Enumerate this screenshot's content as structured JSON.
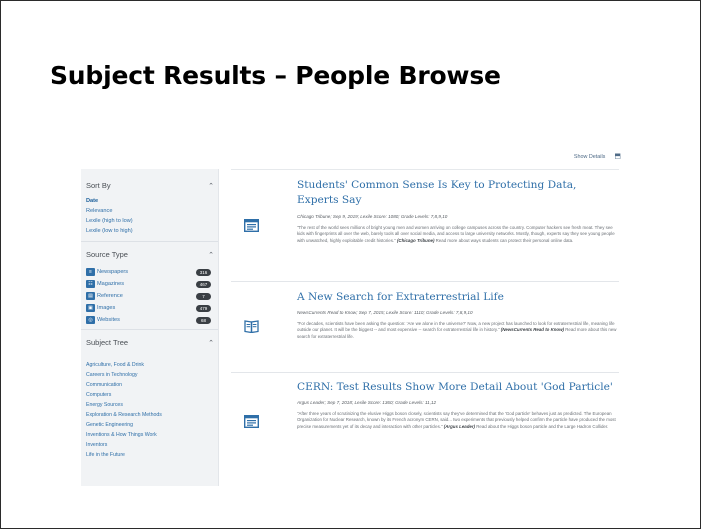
{
  "slide": {
    "title": "Subject Results – People Browse"
  },
  "toolbar": {
    "details_label": "Show Details",
    "details_icon": "collapse-icon"
  },
  "sidebar": {
    "sort_by": {
      "header": "Sort By",
      "items": [
        {
          "label": "Date",
          "active": true
        },
        {
          "label": "Relevance",
          "active": false
        },
        {
          "label": "Lexile (high to low)",
          "active": false
        },
        {
          "label": "Lexile (low to high)",
          "active": false
        }
      ]
    },
    "source_type": {
      "header": "Source Type",
      "items": [
        {
          "label": "Newspapers",
          "count": "316",
          "icon": "newspaper-icon"
        },
        {
          "label": "Magazines",
          "count": "467",
          "icon": "magazine-icon"
        },
        {
          "label": "Reference",
          "count": "7",
          "icon": "reference-icon"
        },
        {
          "label": "Images",
          "count": "479",
          "icon": "image-icon"
        },
        {
          "label": "Websites",
          "count": "68",
          "icon": "website-icon"
        }
      ]
    },
    "subject_tree": {
      "header": "Subject Tree",
      "items": [
        "Agriculture, Food & Drink",
        "Careers in Technology",
        "Communication",
        "Computers",
        "Energy Sources",
        "Exploration & Research Methods",
        "Genetic Engineering",
        "Inventions & How Things Work",
        "Inventors",
        "Life in the Future"
      ]
    }
  },
  "results": [
    {
      "title": "Students' Common Sense Is Key to Protecting Data, Experts Say",
      "meta": "Chicago Tribune; Sep 9, 2019; Lexile Score: 1080; Grade Levels: 7,8,9,10",
      "summary": "\"The rest of the world sees millions of bright young men and women arriving on college campuses across the country. Computer hackers see fresh meat. They see kids with fingerprints all over the web, barely tools all over social media, and access to large university networks. Mostly, though, experts say they see young people with unwatched, highly exploitable credit histories.\"",
      "source": "(Chicago Tribune)",
      "tail": "Read more about ways students can protect their personal online data.",
      "icon": "newspaper-icon"
    },
    {
      "title": "A New Search for Extraterrestrial Life",
      "meta": "NewsCurrents Read to Know; Sep 7, 2015; Lexile Score: 1110; Grade Levels: 7,8,9,10",
      "summary": "\"For decades, scientists have been asking the question: 'Are we alone in the universe?' Now, a new project has launched to look for extraterrestrial life, meaning life outside our planet. It will be the biggest -- and most expensive -- search for extraterrestrial life in history.\"",
      "source": "(NewsCurrents Read to Know)",
      "tail": "Read more about this new search for extraterrestrial life.",
      "icon": "magazine-icon"
    },
    {
      "title": "CERN: Test Results Show More Detail About 'God Particle'",
      "meta": "Argus Leader; Sep 7, 2018; Lexile Score: 1360; Grade Levels: 11,12",
      "summary": "\"After three years of scrutinizing the elusive Higgs boson closely, scientists say they've determined that the 'God particle' behaves just as predicted. The European Organization for Nuclear Research, known by its French acronym CERN, said... two experiments that previously helped confirm the particle have produced the most precise measurements yet of its decay and interaction with other particles.\"",
      "source": "(Argus Leader)",
      "tail": "Read about the Higgs boson particle and the Large Hadron Collider.",
      "icon": "newspaper-icon"
    }
  ],
  "colors": {
    "link": "#2f6fa8",
    "sidebar_bg": "#f1f3f5",
    "badge": "#3a3f44"
  }
}
